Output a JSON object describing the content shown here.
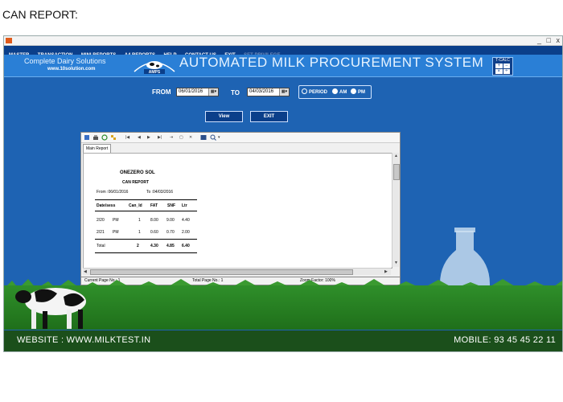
{
  "caption": "CAN REPORT:",
  "window": {
    "controls": {
      "min": "_",
      "max": "□",
      "close": "x"
    }
  },
  "menu": [
    "MASTER",
    "TRANSACTION",
    "MINI REPORTS",
    "A4 REPORTS",
    "HELP",
    "CONTACT US",
    "EXIT",
    "SET PRIVILEGE"
  ],
  "banner": {
    "brand": "Complete Dairy Solutions",
    "site": "www.10solution.com",
    "logo_text": "AMPS",
    "title": "AUTOMATED MILK PROCUREMENT SYSTEM",
    "calc_label": "T-CALC",
    "calc_keys": [
      "+",
      "−",
      "×",
      "÷"
    ]
  },
  "filters": {
    "from_label": "FROM",
    "from_value": "06/01/2016",
    "to_label": "TO",
    "to_value": "04/03/2016",
    "period_label": "PERIOD",
    "am_label": "AM",
    "pm_label": "PM"
  },
  "buttons": {
    "view": "View",
    "exit": "EXIT"
  },
  "viewer": {
    "tab": "Main Report",
    "company": "ONEZERO SOL",
    "report_title": "CAN REPORT",
    "from_text": "From :06/01/2016",
    "to_text": "To :04/03/2016",
    "columns": [
      "Date/sess",
      "Can_Id",
      "FAT",
      "SNF",
      "Ltr"
    ],
    "rows": [
      {
        "date": "2/20",
        "sess": "PM",
        "can": "1",
        "fat": "8.00",
        "snf": "9.00",
        "ltr": "4.40"
      },
      {
        "date": "2/21",
        "sess": "PM",
        "can": "1",
        "fat": "0.60",
        "snf": "0.70",
        "ltr": "2.00"
      }
    ],
    "total": {
      "label": "Total",
      "can": "2",
      "fat": "4.30",
      "snf": "4.85",
      "ltr": "6.40"
    },
    "status": {
      "current_page": "Current Page No.: 1",
      "total_page": "Total Page No.: 1",
      "zoom": "Zoom Factor: 100%"
    }
  },
  "footer": {
    "website": "WEBSITE : WWW.MILKTEST.IN",
    "mobile": "MOBILE: 93 45 45 22 11"
  },
  "colors": {
    "app_bg": "#1e63b3",
    "menubar": "#0b3f8a",
    "banner": "#2a7fd6",
    "grass": "#2f8f2a",
    "footer": "#1b4f1b"
  }
}
